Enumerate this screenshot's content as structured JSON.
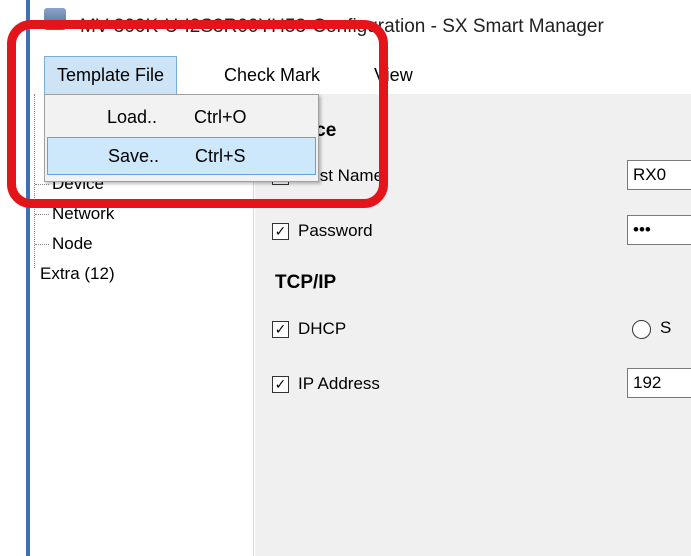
{
  "window": {
    "title": "MV-300K-U-I2S3R00YH53-Configuration - SX Smart Manager"
  },
  "menubar": {
    "items": [
      {
        "label": "Template File",
        "open": true
      },
      {
        "label": "Check Mark"
      },
      {
        "label": "View"
      }
    ]
  },
  "dropdown": {
    "items": [
      {
        "label": "Load..",
        "shortcut": "Ctrl+O",
        "highlighted": false
      },
      {
        "label": "Save..",
        "shortcut": "Ctrl+S",
        "highlighted": true
      }
    ]
  },
  "tree": {
    "items": [
      "Device",
      "Network",
      "Node",
      "Extra (12)"
    ]
  },
  "form": {
    "device_section": "Device",
    "host_name_label": "Host Name",
    "host_name_value": "RX0",
    "password_label": "Password",
    "password_value": "•••",
    "tcpip_section": "TCP/IP",
    "dhcp_label": "DHCP",
    "static_label": "S",
    "ip_address_label": "IP Address",
    "ip_address_value": "192"
  },
  "annotation": {
    "color": "#e3151b"
  }
}
